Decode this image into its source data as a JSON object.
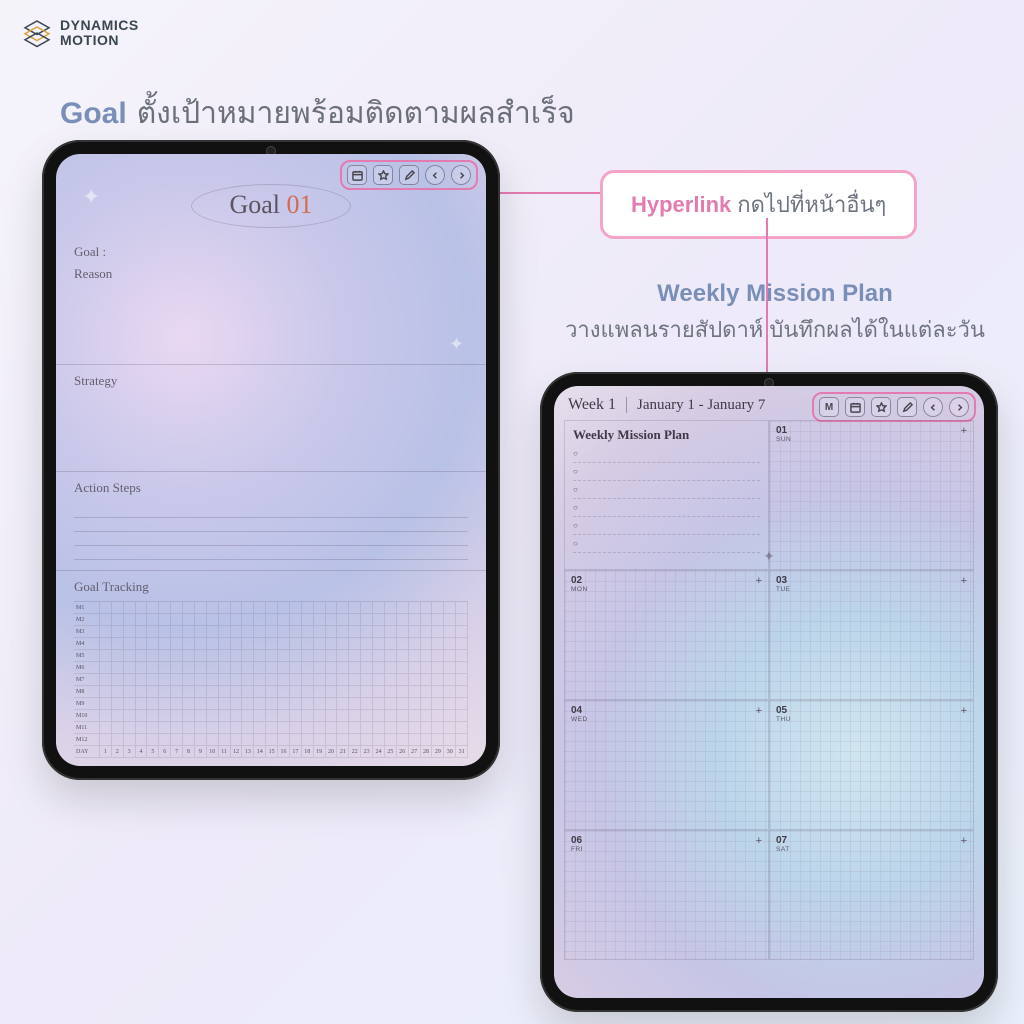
{
  "brand": {
    "line1": "DYNAMICS",
    "line2": "MOTION"
  },
  "headings": {
    "goal_strong": "Goal",
    "goal_rest": "ตั้งเป้าหมายพร้อมติดตามผลสำเร็จ",
    "weekly_strong": "Weekly Mission Plan",
    "weekly_rest": "วางแพลนรายสัปดาห์ บันทึกผลได้ในแต่ละวัน"
  },
  "callout": {
    "strong": "Hyperlink",
    "rest": "กดไปที่หน้าอื่นๆ"
  },
  "toolbar_icons": [
    "calendar",
    "star",
    "edit",
    "prev",
    "next"
  ],
  "toolbar_icons_b": [
    "M",
    "calendar",
    "star",
    "edit",
    "prev",
    "next"
  ],
  "tabletA": {
    "title_prefix": "Goal ",
    "title_num": "01",
    "labels": {
      "goal": "Goal :",
      "reason": "Reason",
      "strategy": "Strategy",
      "steps": "Action Steps",
      "tracking": "Goal Tracking",
      "day": "DAY"
    },
    "months": [
      "M1",
      "M2",
      "M3",
      "M4",
      "M5",
      "M6",
      "M7",
      "M8",
      "M9",
      "M10",
      "M11",
      "M12"
    ],
    "days": [
      "1",
      "2",
      "3",
      "4",
      "5",
      "6",
      "7",
      "8",
      "9",
      "10",
      "11",
      "12",
      "13",
      "14",
      "15",
      "16",
      "17",
      "18",
      "19",
      "20",
      "21",
      "22",
      "23",
      "24",
      "25",
      "26",
      "27",
      "28",
      "29",
      "30",
      "31"
    ]
  },
  "tabletB": {
    "week": "Week 1",
    "range": "January 1 - January 7",
    "plan_title": "Weekly Mission Plan",
    "m_label": "M",
    "cells": [
      {
        "num": "01",
        "dow": "SUN"
      },
      {
        "num": "02",
        "dow": "MON"
      },
      {
        "num": "03",
        "dow": "TUE"
      },
      {
        "num": "04",
        "dow": "WED"
      },
      {
        "num": "05",
        "dow": "THU"
      },
      {
        "num": "06",
        "dow": "FRI"
      },
      {
        "num": "07",
        "dow": "SAT"
      }
    ]
  }
}
